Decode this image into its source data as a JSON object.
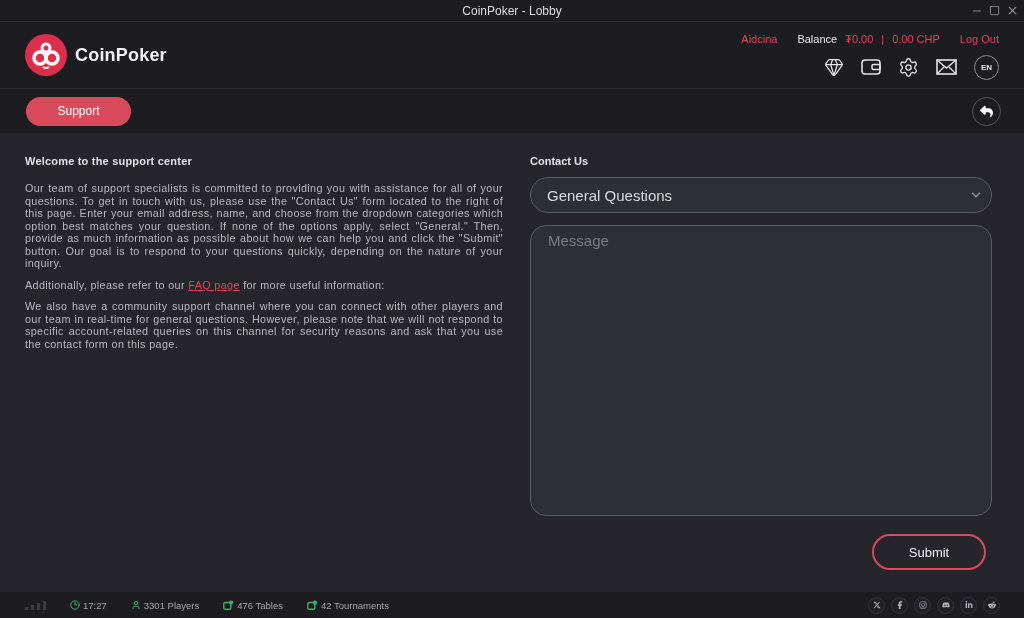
{
  "window": {
    "title": "CoinPoker - Lobby"
  },
  "header": {
    "brand": "CoinPoker",
    "username": "Aidcina",
    "balance_label": "Balance",
    "balance_usdt": "₮0.00",
    "balance_separator": "|",
    "balance_chp": "0.00 CHP",
    "logout": "Log Out",
    "language": "EN"
  },
  "nav": {
    "support_button": "Support"
  },
  "support": {
    "heading": "Welcome to the support center",
    "paragraphs": [
      {
        "text": "Our team of support specialists is committed to providing you with assistance for all of your questions. To get in touch with us, please use the \"Contact Us\" form located to the right of this page. Enter your email address, name, and choose from the dropdown categories which option best matches your question. If none of the options apply, select \"General.\" Then, provide as much information as possible about how we can help you and click the \"Submit\" button. Our goal is to respond to your questions quickly, depending on the nature of your inquiry."
      },
      {
        "text": "Additionally, please refer to our ",
        "link": "FAQ page",
        "after": " for more useful information:"
      },
      {
        "text": "We also have a community support channel where you can connect with other players and our team in real-time for general questions. However, please note that we will not respond to specific account-related queries on this channel for security reasons and ask that you use the contact form on this page."
      }
    ]
  },
  "contact": {
    "heading": "Contact Us",
    "category": "General Questions",
    "message": {
      "placeholder": "Message"
    },
    "submit": "Submit"
  },
  "status_bar": {
    "items": [
      {
        "kind": "clock",
        "text": "17:27"
      },
      {
        "kind": "players",
        "text": "3301 Players"
      },
      {
        "kind": "tables",
        "text": "476 Tables"
      },
      {
        "kind": "tournaments",
        "text": "42 Tournaments"
      }
    ]
  }
}
